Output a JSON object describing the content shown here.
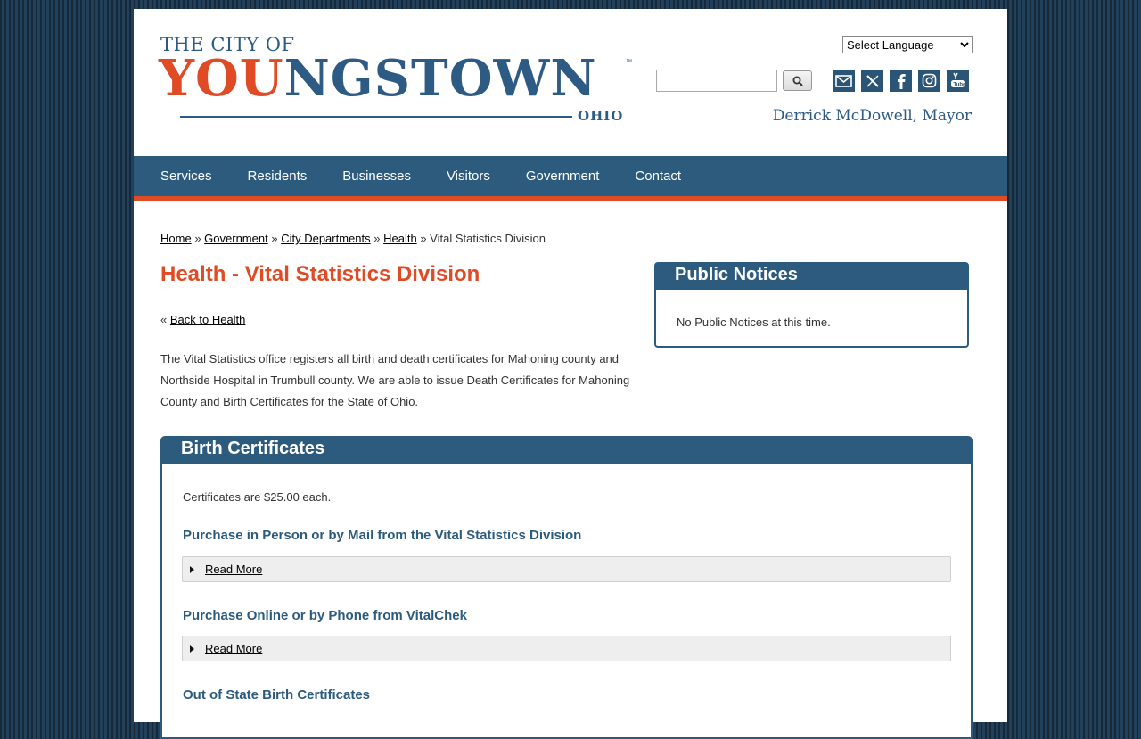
{
  "header": {
    "logo": {
      "top": "THE CITY OF",
      "main_red": "YOU",
      "main_blue": "NGSTOWN",
      "tm": "™",
      "sub": "OHIO"
    },
    "language_select": "Select Language",
    "search_placeholder": "",
    "mayor": "Derrick McDowell, Mayor"
  },
  "nav": {
    "items": [
      "Services",
      "Residents",
      "Businesses",
      "Visitors",
      "Government",
      "Contact"
    ]
  },
  "breadcrumb": {
    "home": "Home",
    "government": "Government",
    "city_departments": "City Departments",
    "health": "Health",
    "current": "Vital Statistics Division",
    "sep": "»"
  },
  "page": {
    "title": "Health - Vital Statistics Division",
    "back_prefix": "«",
    "back_link": "Back to Health",
    "intro": "The Vital Statistics office registers all birth and death certificates for Mahoning county and Northside Hospital in Trumbull county. We are able to issue Death Certificates for Mahoning County and Birth Certificates for the State of Ohio."
  },
  "notices": {
    "title": "Public Notices",
    "text": "No Public Notices at this time."
  },
  "birth": {
    "title": "Birth Certificates",
    "price": "Certificates are $25.00 each.",
    "sections": [
      {
        "heading": "Purchase in Person or by Mail from the Vital Statistics Division",
        "toggle": "Read More"
      },
      {
        "heading": "Purchase Online or by Phone from VitalChek",
        "toggle": "Read More"
      },
      {
        "heading": "Out of State Birth Certificates"
      }
    ]
  },
  "icons": {
    "social": [
      "email-icon",
      "x-twitter-icon",
      "facebook-icon",
      "instagram-icon",
      "youtube-icon"
    ]
  },
  "colors": {
    "brand_blue": "#2d5b7e",
    "brand_orange": "#e04a24"
  }
}
